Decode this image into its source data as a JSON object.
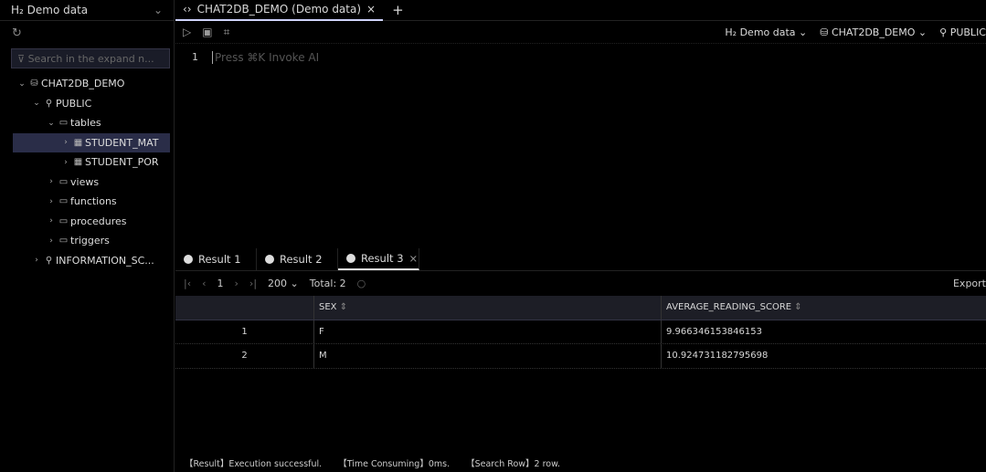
{
  "sidebar": {
    "datasource": "H₂ Demo data",
    "search_placeholder": "Search in the expand n...",
    "tree": [
      {
        "label": "CHAT2DB_DEMO",
        "icon": "database-icon",
        "expanded": true,
        "level": 0
      },
      {
        "label": "PUBLIC",
        "icon": "schema-icon",
        "expanded": true,
        "level": 1
      },
      {
        "label": "tables",
        "icon": "folder-icon",
        "expanded": true,
        "level": 2
      },
      {
        "label": "STUDENT_MAT",
        "icon": "table-icon",
        "expanded": false,
        "level": 3,
        "selected": true
      },
      {
        "label": "STUDENT_POR",
        "icon": "table-icon",
        "expanded": false,
        "level": 3
      },
      {
        "label": "views",
        "icon": "folder-icon",
        "expanded": false,
        "level": 2
      },
      {
        "label": "functions",
        "icon": "folder-icon",
        "expanded": false,
        "level": 2
      },
      {
        "label": "procedures",
        "icon": "folder-icon",
        "expanded": false,
        "level": 2
      },
      {
        "label": "triggers",
        "icon": "folder-icon",
        "expanded": false,
        "level": 2
      },
      {
        "label": "INFORMATION_SC...",
        "icon": "schema-icon",
        "expanded": false,
        "level": 1
      }
    ]
  },
  "tab": {
    "label": "CHAT2DB_DEMO (Demo data)"
  },
  "toolbar": {
    "datasource": "H₂ Demo data",
    "database": "CHAT2DB_DEMO",
    "schema": "PUBLIC"
  },
  "editor": {
    "line": "1",
    "placeholder": "Press ⌘K Invoke AI"
  },
  "results": {
    "tabs": [
      "Result 1",
      "Result 2",
      "Result 3"
    ],
    "active": 2,
    "pager": {
      "page": "1",
      "page_size": "200",
      "total": "Total: 2",
      "export": "Export"
    },
    "columns": [
      "SEX",
      "AVERAGE_READING_SCORE"
    ],
    "rows": [
      [
        "1",
        "F",
        "9.966346153846153"
      ],
      [
        "2",
        "M",
        "10.924731182795698"
      ]
    ]
  },
  "status": {
    "result": "【Result】Execution successful.",
    "time": "【Time Consuming】0ms.",
    "rows": "【Search Row】2 row."
  }
}
